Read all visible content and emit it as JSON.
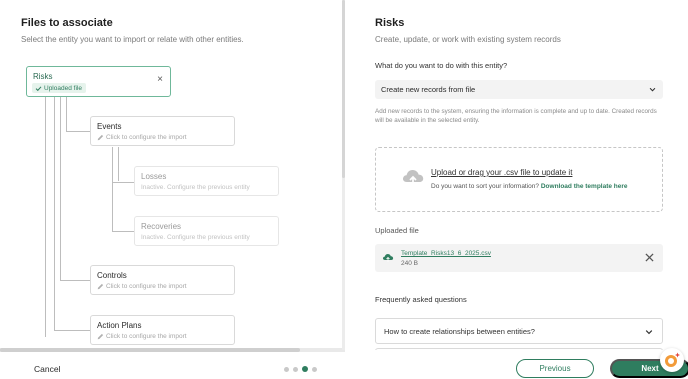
{
  "left": {
    "title": "Files to associate",
    "subtitle": "Select the entity you want to import or relate with other entities.",
    "root": {
      "name": "Risks",
      "badge": "Uploaded file",
      "close": "×"
    },
    "nodes": [
      {
        "name": "Events",
        "hint": "Click to configure the import",
        "dim": false
      },
      {
        "name": "Losses",
        "hint": "Inactive. Configure the previous entity",
        "dim": true
      },
      {
        "name": "Recoveries",
        "hint": "Inactive. Configure the previous entity",
        "dim": true
      },
      {
        "name": "Controls",
        "hint": "Click to configure the import",
        "dim": false
      },
      {
        "name": "Action Plans",
        "hint": "Click to configure the import",
        "dim": false
      }
    ]
  },
  "right": {
    "title": "Risks",
    "subtitle": "Create, update, or work with existing system records",
    "question": "What do you want to do with this entity?",
    "select_value": "Create new records from file",
    "help": "Add new records to the system, ensuring the information is complete and up to date. Created records will be available in the selected entity.",
    "upload_link": "Upload or drag your .csv file to update it",
    "sort_question": "Do you want to sort your information?",
    "download_template": "Download the template here",
    "uploaded_label": "Uploaded file",
    "file": {
      "name": "Template_Risks13_6_2025.csv",
      "size": "240 B"
    },
    "faq_label": "Frequently asked questions",
    "faq_item": "How to create relationships between entities?"
  },
  "footer": {
    "cancel": "Cancel",
    "previous": "Previous",
    "next": "Next",
    "step_current": 3,
    "step_total": 4
  },
  "colors": {
    "accent": "#2f7d5f",
    "accent_light": "#e6f3ec"
  }
}
